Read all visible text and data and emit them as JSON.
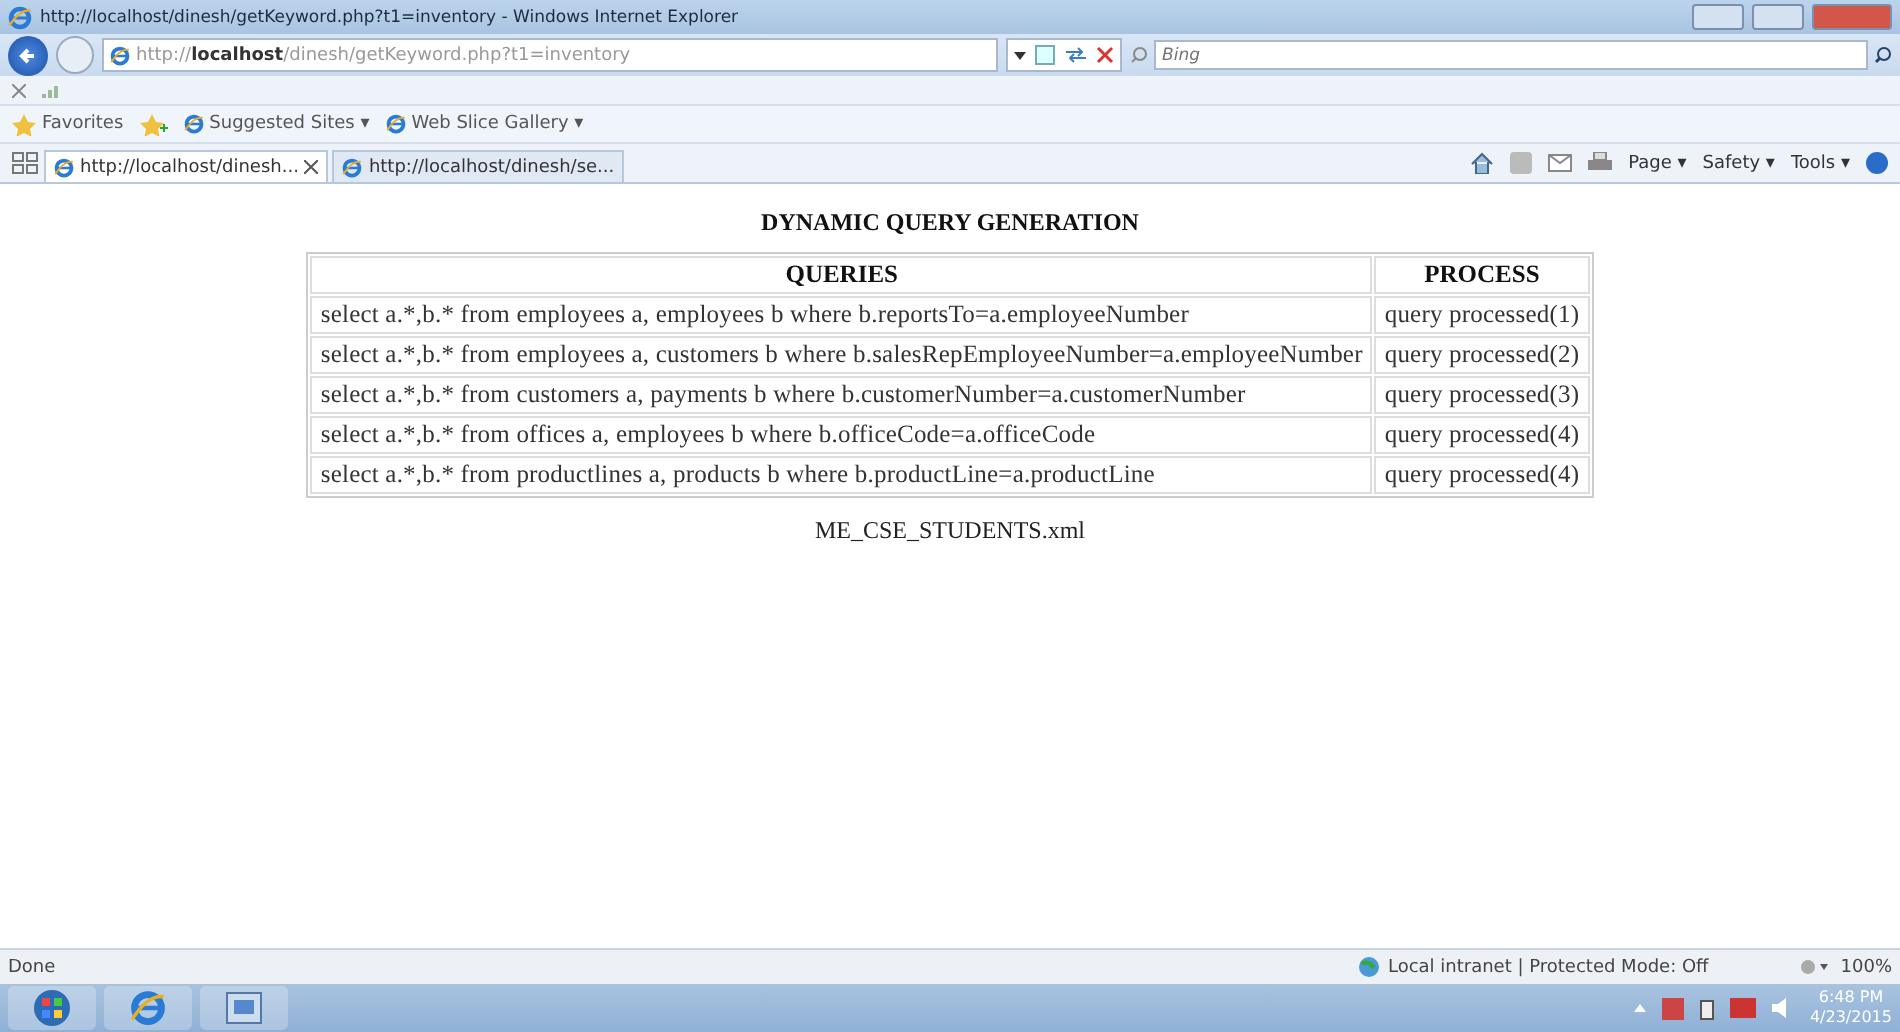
{
  "window": {
    "title": "http://localhost/dinesh/getKeyword.php?t1=inventory - Windows Internet Explorer"
  },
  "address_bar": {
    "url_host_prefix": "http://",
    "url_host": "localhost",
    "url_path": "/dinesh/getKeyword.php?t1=inventory",
    "search_placeholder": "Bing"
  },
  "favorites_bar": {
    "favorites": "Favorites",
    "items": [
      "Suggested Sites ▾",
      "Web Slice Gallery ▾"
    ]
  },
  "tabs": [
    {
      "label": "http://localhost/dinesh...",
      "selected": true
    },
    {
      "label": "http://localhost/dinesh/se...",
      "selected": false
    }
  ],
  "command_bar": [
    "Page ▾",
    "Safety ▾",
    "Tools ▾"
  ],
  "page": {
    "heading": "DYNAMIC QUERY GENERATION",
    "table": {
      "columns": [
        "QUERIES",
        "PROCESS"
      ],
      "rows": [
        [
          "select a.*,b.* from employees a, employees b where b.reportsTo=a.employeeNumber",
          "query processed(1)"
        ],
        [
          "select a.*,b.* from employees a, customers b where b.salesRepEmployeeNumber=a.employeeNumber",
          "query processed(2)"
        ],
        [
          "select a.*,b.* from customers a, payments b where b.customerNumber=a.customerNumber",
          "query processed(3)"
        ],
        [
          "select a.*,b.* from offices a, employees b where b.officeCode=a.officeCode",
          "query processed(4)"
        ],
        [
          "select a.*,b.* from productlines a, products b where b.productLine=a.productLine",
          "query processed(4)"
        ]
      ]
    },
    "footer_text": "ME_CSE_STUDENTS.xml"
  },
  "status_bar": {
    "status": "Done",
    "zone": "Local intranet | Protected Mode: Off",
    "zoom": "100%"
  },
  "taskbar": {
    "time": "6:48 PM",
    "date": "4/23/2015"
  }
}
